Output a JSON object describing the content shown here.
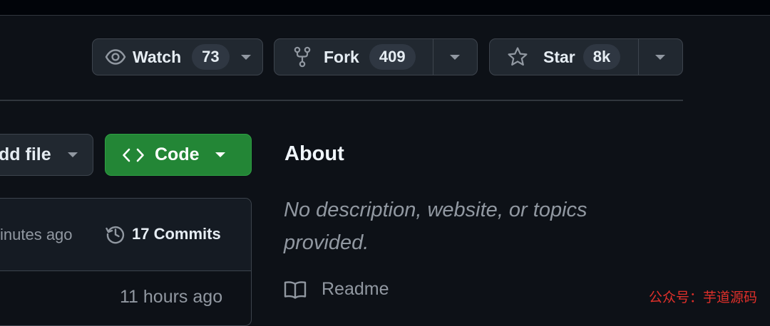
{
  "header": {
    "watch": {
      "label": "Watch",
      "count": "73",
      "icon": "eye-icon"
    },
    "fork": {
      "label": "Fork",
      "count": "409",
      "icon": "repo-forked-icon"
    },
    "star": {
      "label": "Star",
      "count": "8k",
      "icon": "star-icon"
    }
  },
  "toolbar": {
    "add_file_label": "dd file",
    "code_label": "Code"
  },
  "latest_commit": {
    "time": "inutes ago",
    "commits_label": "17 Commits",
    "row_time": "11 hours ago"
  },
  "about": {
    "title": "About",
    "description": "No description, website, or topics provided.",
    "readme_label": "Readme"
  },
  "watermark": "公众号：芋道源码",
  "colors": {
    "background": "#0d1117",
    "button_bg": "#212830",
    "border": "#3d444d",
    "code_green": "#238636",
    "muted_text": "#9198a1",
    "watermark": "#e0302a"
  }
}
